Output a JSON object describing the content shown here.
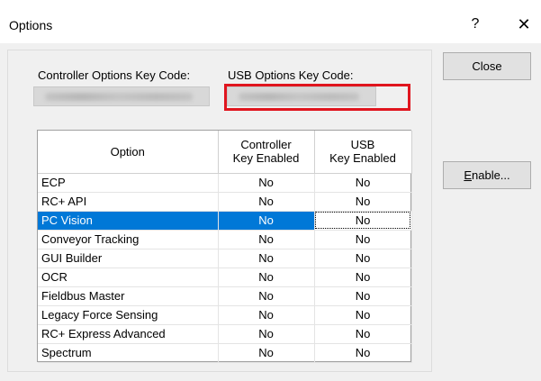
{
  "window": {
    "title": "Options",
    "help_glyph": "?",
    "close_glyph": "✕"
  },
  "labels": {
    "controller_key": "Controller Options Key Code:",
    "usb_key": "USB Options Key Code:"
  },
  "buttons": {
    "close": "Close",
    "enable_mnemonic": "E",
    "enable_rest": "nable..."
  },
  "table": {
    "headers": {
      "option": "Option",
      "controller_line1": "Controller",
      "controller_line2": "Key Enabled",
      "usb_line1": "USB",
      "usb_line2": "Key Enabled"
    },
    "rows": [
      {
        "option": "ECP",
        "controller": "No",
        "usb": "No"
      },
      {
        "option": "RC+ API",
        "controller": "No",
        "usb": "No"
      },
      {
        "option": "PC Vision",
        "controller": "No",
        "usb": "No",
        "selected": true
      },
      {
        "option": "Conveyor Tracking",
        "controller": "No",
        "usb": "No"
      },
      {
        "option": "GUI Builder",
        "controller": "No",
        "usb": "No"
      },
      {
        "option": "OCR",
        "controller": "No",
        "usb": "No"
      },
      {
        "option": "Fieldbus Master",
        "controller": "No",
        "usb": "No"
      },
      {
        "option": "Legacy Force Sensing",
        "controller": "No",
        "usb": "No"
      },
      {
        "option": "RC+ Express Advanced",
        "controller": "No",
        "usb": "No"
      },
      {
        "option": "Spectrum",
        "controller": "No",
        "usb": "No"
      }
    ]
  },
  "colors": {
    "highlight_border": "#e0151e",
    "selection": "#0078d7"
  }
}
